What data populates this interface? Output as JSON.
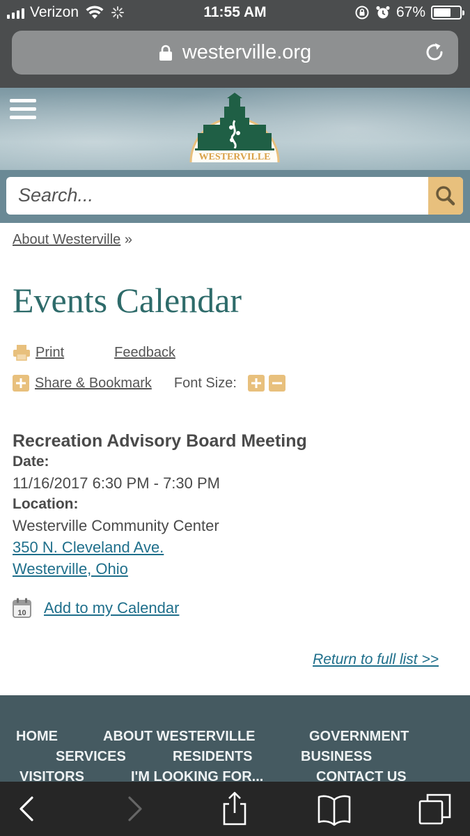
{
  "status_bar": {
    "carrier": "Verizon",
    "time": "11:55 AM",
    "battery_percent": "67%",
    "battery_level": 0.67
  },
  "url_bar": {
    "domain": "westerville.org"
  },
  "header": {
    "logo_text": "WESTERVILLE",
    "search_placeholder": "Search..."
  },
  "breadcrumb": {
    "link": "About Westerville",
    "separator": "»"
  },
  "page_title": "Events Calendar",
  "tools": {
    "print_label": "Print",
    "feedback_label": "Feedback",
    "share_label": "Share & Bookmark",
    "font_size_label": "Font Size:"
  },
  "event": {
    "title": "Recreation Advisory Board Meeting",
    "date_label": "Date:",
    "date_value": "11/16/2017 6:30 PM - 7:30 PM",
    "location_label": "Location:",
    "location_name": "Westerville Community Center",
    "address_line1": "350 N. Cleveland Ave.",
    "address_line2": "Westerville, Ohio",
    "add_to_calendar": "Add to my Calendar",
    "calendar_icon_day": "10",
    "return_link": "Return to full list >>"
  },
  "footer_nav": {
    "home": "HOME",
    "about": "ABOUT WESTERVILLE",
    "government": "GOVERNMENT",
    "services": "SERVICES",
    "residents": "RESIDENTS",
    "business": "BUSINESS",
    "visitors": "VISITORS",
    "looking_for": "I'M LOOKING FOR...",
    "contact": "CONTACT US"
  },
  "colors": {
    "title_teal": "#2e6b6a",
    "link_blue": "#1f6f8b",
    "accent_gold": "#e8c07d",
    "logo_green": "#1f5f45",
    "footer_bg": "#455a61"
  }
}
